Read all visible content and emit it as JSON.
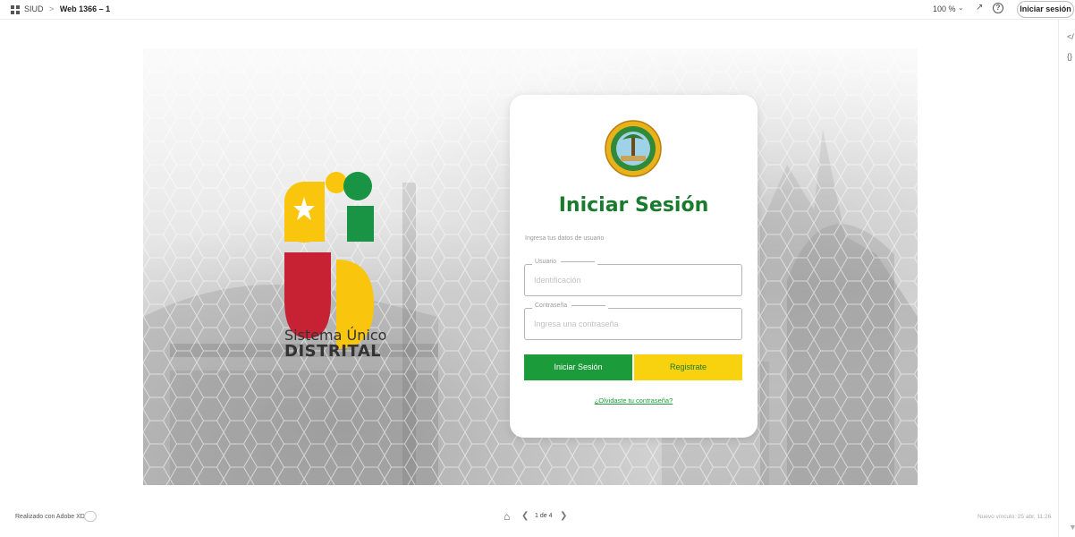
{
  "topbar": {
    "project": "SIUD",
    "separator": ">",
    "page": "Web 1366 – 1",
    "zoom": "100 %",
    "signin_label": "Iniciar sesión"
  },
  "artboard": {
    "logo_line1": "Sistema Único",
    "logo_line2": "DISTRITAL"
  },
  "login": {
    "title": "Iniciar Sesión",
    "subtitle": "Ingresa tus datos de usuario",
    "user_label": "Usuario",
    "user_placeholder": "Identificación",
    "user_value": "",
    "pass_label": "Contraseña",
    "pass_placeholder": "Ingresa una contraseña",
    "pass_value": "",
    "login_button": "Iniciar Sesión",
    "register_button": "Registrate",
    "forgot_link": "¿Olvidaste tu contraseña?"
  },
  "footer": {
    "made_with": "Realizado con Adobe XD",
    "pager": "1 de 4",
    "last_view": "Nuevo vínculo: 25 abr, 11:26"
  },
  "colors": {
    "primary_green": "#1c9b3a",
    "title_green": "#1a7a2e",
    "yellow": "#f8d20f",
    "logo_red": "#c62233",
    "logo_green": "#199445",
    "logo_yellow": "#f9c50d"
  },
  "icons": [
    "grid-icon",
    "expand-icon",
    "help-icon",
    "code-icon",
    "brace-icon",
    "filter-icon",
    "home-icon",
    "chevron-left-icon",
    "chevron-right-icon"
  ]
}
